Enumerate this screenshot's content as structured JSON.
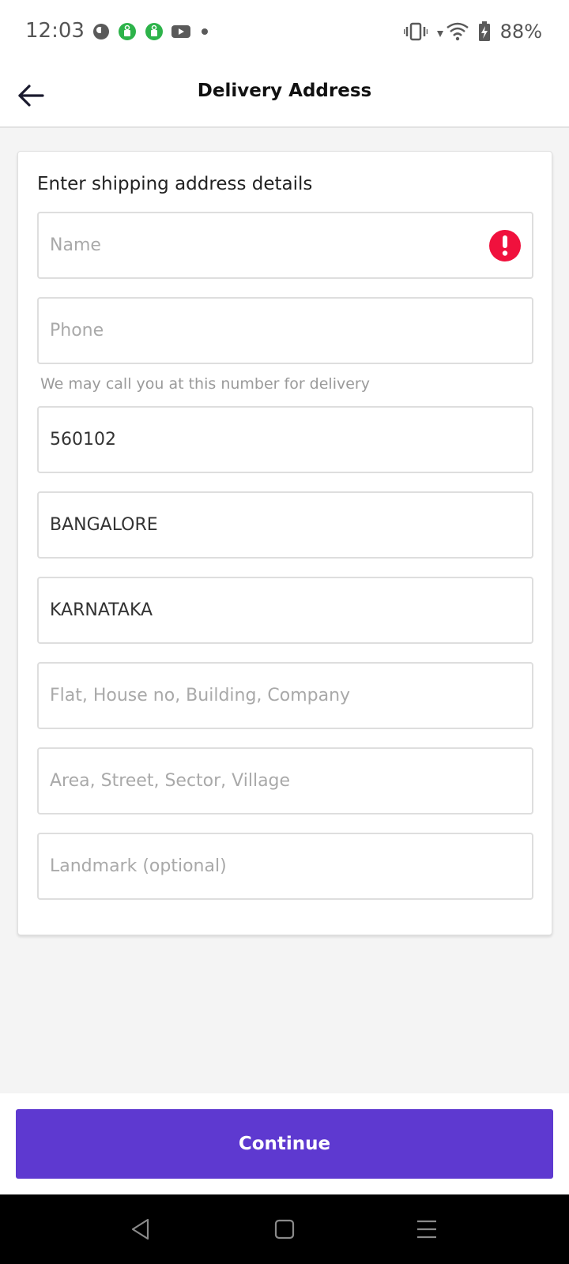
{
  "status_bar": {
    "time": "12:03",
    "battery": "88%",
    "left_icons": [
      "app-notification-icon",
      "green-app-icon",
      "green-app-icon",
      "youtube-icon",
      "dot-icon"
    ],
    "right_icons": [
      "vibrate-icon",
      "wifi-icon",
      "battery-charging-icon"
    ]
  },
  "app_bar": {
    "title": "Delivery Address",
    "back_icon": "arrow-left-icon"
  },
  "form": {
    "heading": "Enter shipping address details",
    "name": {
      "value": "",
      "placeholder": "Name",
      "error_icon": "error-exclamation-icon",
      "error_color": "#f0113d"
    },
    "phone": {
      "value": "",
      "placeholder": "Phone",
      "helper": "We may call you at this number for delivery"
    },
    "pincode": {
      "value": "560102",
      "placeholder": ""
    },
    "city": {
      "value": "BANGALORE",
      "placeholder": ""
    },
    "state": {
      "value": "KARNATAKA",
      "placeholder": ""
    },
    "flat": {
      "value": "",
      "placeholder": "Flat, House no, Building, Company"
    },
    "area": {
      "value": "",
      "placeholder": "Area, Street, Sector, Village"
    },
    "landmark": {
      "value": "",
      "placeholder": "Landmark (optional)"
    }
  },
  "footer": {
    "continue_label": "Continue",
    "accent_color": "#5e39d0"
  },
  "nav_bar": {
    "icons": [
      "back-triangle-icon",
      "home-square-icon",
      "menu-lines-icon"
    ]
  }
}
